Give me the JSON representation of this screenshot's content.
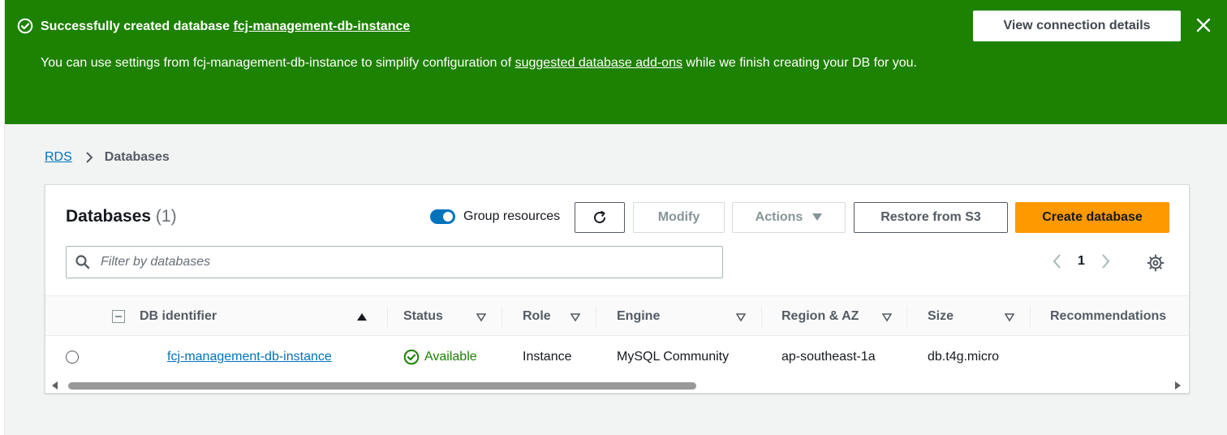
{
  "flash": {
    "title_prefix": "Successfully created database ",
    "title_db": "fcj-management-db-instance",
    "message_part1": "You can use settings from fcj-management-db-instance to simplify configuration of ",
    "message_link": "suggested database add-ons",
    "message_part2": " while we finish creating your DB for you.",
    "view_button": "View connection details",
    "close_icon": "close-icon",
    "status_icon": "check-circle-icon",
    "color": "#1d8102"
  },
  "breadcrumb": {
    "root": "RDS",
    "current": "Databases"
  },
  "panel": {
    "title": "Databases",
    "count": "(1)",
    "group_toggle_label": "Group resources",
    "group_toggle_on": true,
    "refresh_icon": "refresh-icon",
    "modify_label": "Modify",
    "actions_label": "Actions",
    "restore_label": "Restore from S3",
    "create_label": "Create database",
    "search_placeholder": "Filter by databases",
    "page_number": "1",
    "settings_icon": "gear-icon"
  },
  "table": {
    "columns": [
      "DB identifier",
      "Status",
      "Role",
      "Engine",
      "Region & AZ",
      "Size",
      "Recommendations"
    ],
    "rows": [
      {
        "db_identifier": "fcj-management-db-instance",
        "status": "Available",
        "role": "Instance",
        "engine": "MySQL Community",
        "region_az": "ap-southeast-1a",
        "size": "db.t4g.micro",
        "recommendations": ""
      }
    ]
  },
  "colors": {
    "accent": "#0073bb",
    "primary_button": "#ff9900",
    "success": "#1d8102"
  }
}
